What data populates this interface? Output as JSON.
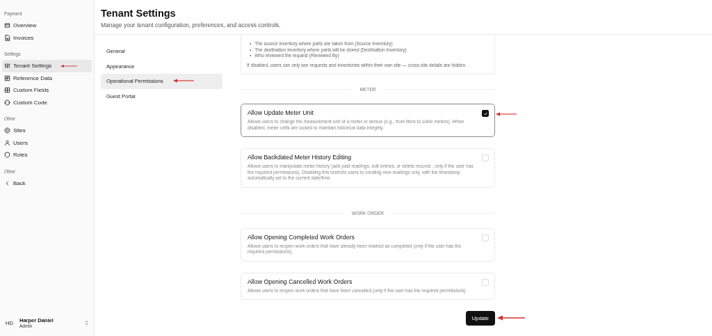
{
  "sidebar": {
    "sections": [
      {
        "label": "Payment",
        "items": [
          {
            "label": "Overview",
            "selected": false,
            "annotated": false
          },
          {
            "label": "Invoices",
            "selected": false,
            "annotated": false
          }
        ]
      },
      {
        "label": "Settings",
        "items": [
          {
            "label": "Tenant Settings",
            "selected": true,
            "annotated": true
          },
          {
            "label": "Reference Data",
            "selected": false,
            "annotated": false
          },
          {
            "label": "Custom Fields",
            "selected": false,
            "annotated": false
          },
          {
            "label": "Custom Code",
            "selected": false,
            "annotated": false
          }
        ]
      },
      {
        "label": "Other",
        "items": [
          {
            "label": "Sites",
            "selected": false,
            "annotated": false
          },
          {
            "label": "Users",
            "selected": false,
            "annotated": false
          },
          {
            "label": "Roles",
            "selected": false,
            "annotated": false
          }
        ]
      },
      {
        "label": "Other",
        "items": [
          {
            "label": "Back",
            "selected": false,
            "annotated": false
          }
        ]
      }
    ],
    "user": {
      "initials": "HD",
      "name": "Harper Daniel",
      "role": "Admin"
    }
  },
  "header": {
    "title": "Tenant Settings",
    "subtitle": "Manage your tenant configuration, preferences, and access controls."
  },
  "settings_nav": [
    {
      "label": "General",
      "selected": false,
      "annotated": false
    },
    {
      "label": "Appearance",
      "selected": false,
      "annotated": false
    },
    {
      "label": "Operational Permissions",
      "selected": true,
      "annotated": true
    },
    {
      "label": "Guest Portal",
      "selected": false,
      "annotated": false
    }
  ],
  "partial_card": {
    "bullets": [
      {
        "marker": "•",
        "text": "The source inventory where parts are taken from (Source Inventory)"
      },
      {
        "marker": "•",
        "text": "The destination inventory where parts will be stored (Destination Inventory)"
      },
      {
        "marker": "•",
        "text": "Who reviewed the request (Reviewed By)"
      }
    ],
    "note": "If disabled, users can only see requests and inventories within their own site — cross-site details are hidden."
  },
  "groups": [
    {
      "heading": "METER",
      "settings": [
        {
          "title": "Allow Update Meter Unit",
          "description": "Allows users to change the measurement unit of a meter or sensor (e.g., from liters to cubic meters). When disabled, meter units are locked to maintain historical data integrity.",
          "checked": true,
          "annotated": true
        },
        {
          "title": "Allow Backdated Meter History Editing",
          "description": "Allows users to manipulate meter history (add past readings, edit entries, or delete records ; only if the user has the required permissions). Disabling this restricts users to creating new readings only, with the timestamp automatically set to the current date/time.",
          "checked": false,
          "annotated": false
        }
      ]
    },
    {
      "heading": "WORK ORDER",
      "settings": [
        {
          "title": "Allow Opening Completed Work Orders",
          "description": "Allows users to reopen work orders that have already been marked as completed (only if the user has the required permissions).",
          "checked": false,
          "annotated": false
        },
        {
          "title": "Allow Opening Cancelled Work Orders",
          "description": "Allows users to reopen work orders that have been cancelled (only if the user has the required permissions).",
          "checked": false,
          "annotated": false
        }
      ]
    }
  ],
  "update_button": {
    "label": "Update",
    "annotated": true
  }
}
